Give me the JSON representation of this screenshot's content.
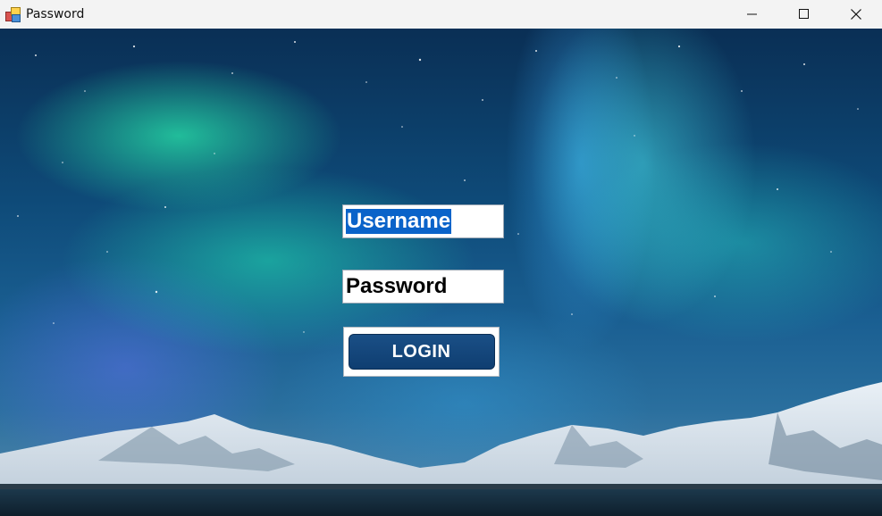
{
  "window": {
    "title": "Password",
    "controls": {
      "minimize": "minimize-icon",
      "maximize": "maximize-icon",
      "close": "close-icon"
    }
  },
  "form": {
    "username": {
      "value": "Username",
      "selected": true
    },
    "password": {
      "value": "Password"
    },
    "login_label": "LOGIN"
  },
  "colors": {
    "login_button": "#0f3e71",
    "selection": "#0a63c9",
    "titlebar": "#f3f3f3"
  }
}
